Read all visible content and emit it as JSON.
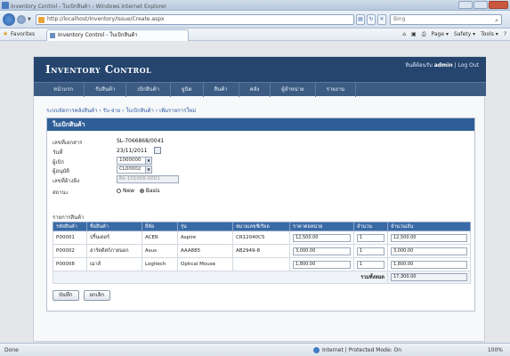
{
  "browser": {
    "window_title": "Inventory Control - ใบเบิกสินค้า - Windows Internet Explorer",
    "url": "http://localhost/Inventory/Issue/Create.aspx",
    "search_placeholder": "Bing",
    "favorites_label": "Favorites",
    "tab_title": "Inventory Control - ใบเบิกสินค้า",
    "command_items": [
      "Page ▾",
      "Safety ▾",
      "Tools ▾"
    ],
    "status_text": "Done",
    "zone_text": "Internet | Protected Mode: On",
    "zoom_text": "100%"
  },
  "app": {
    "title": "Inventory Control",
    "user_prefix": "ยินดีต้อนรับ",
    "user_name": "admin",
    "logout": "Log Out",
    "menu": [
      "หน้าแรก",
      "รับสินค้า",
      "เบิกสินค้า",
      "ยูนิต",
      "สินค้า",
      "คลัง",
      "ผู้จำหน่าย",
      "รายงาน"
    ],
    "breadcrumb": "ระบบจัดการคลังสินค้า › รับ-จ่าย › ใบเบิกสินค้า › เพิ่มรายการใหม่"
  },
  "form": {
    "panel_title": "ใบเบิกสินค้า",
    "fields": {
      "doc_no_label": "เลขที่เอกสาร",
      "doc_no_value": "SL-7066868/0041",
      "date_label": "วันที่",
      "date_value": "23/11/2011",
      "requester_label": "ผู้เบิก",
      "requester_value": "1000000",
      "receiver_label": "ผู้อนุมัติ",
      "receiver_value": "CL00002",
      "ref_label": "เลขที่อ้างอิง",
      "ref_value": "Bk-101006-0001",
      "type_label": "สถานะ",
      "type_options": [
        "New",
        "Basis"
      ],
      "type_selected": "Basis"
    },
    "items_label": "รายการสินค้า",
    "table": {
      "headers": [
        "รหัสสินค้า",
        "ชื่อสินค้า",
        "ยี่ห้อ",
        "รุ่น",
        "หมายเลขซีเรียล",
        "ราคาต่อหน่วย",
        "จำนวน",
        "จำนวนเงิน"
      ],
      "rows": [
        [
          "P00001",
          "ปริ้นเตอร์",
          "ACER",
          "Aspire",
          "CR12040C5",
          "12,500.00",
          "1",
          "12,500.00"
        ],
        [
          "P00002",
          "ฮาร์ดดิสก์ภายนอก",
          "Asus",
          "AAA885",
          "AB2949-8",
          "3,000.00",
          "1",
          "3,000.00"
        ],
        [
          "P00008",
          "เมาส์",
          "Logitech",
          "Optical Mouse",
          "",
          "1,800.00",
          "1",
          "1,800.00"
        ]
      ],
      "total_label": "รวมทั้งหมด",
      "total_value": "17,300.00"
    },
    "buttons": {
      "save": "บันทึก",
      "cancel": "ยกเลิก"
    }
  },
  "colors": {
    "header_bg": "#25456e",
    "menu_bg": "#3d5c83",
    "panel_header": "#2f5e97",
    "table_header": "#3a6aa6"
  }
}
